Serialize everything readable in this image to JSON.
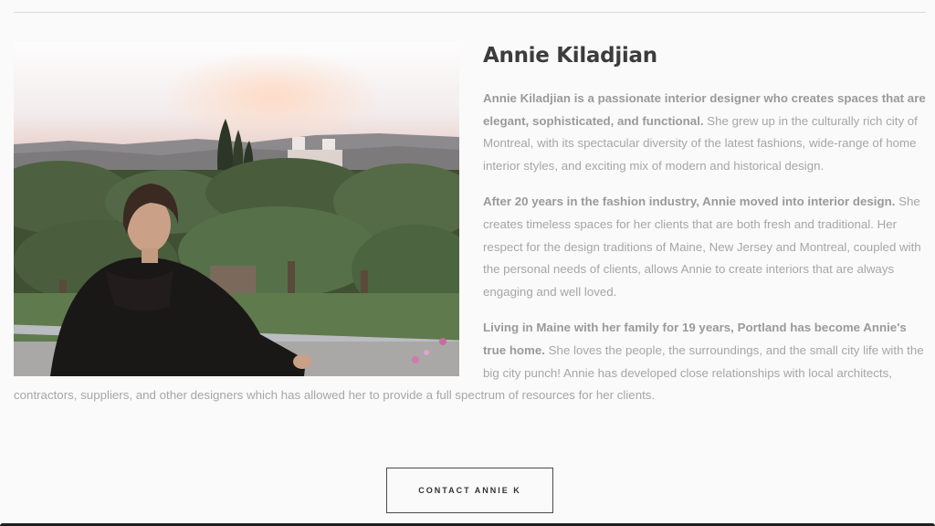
{
  "profile": {
    "name": "Annie Kiladjian",
    "photo_alt": "Annie Kiladjian",
    "paragraphs": [
      {
        "lead": "Annie Kiladjian is a passionate interior designer who creates spaces that are elegant, sophisticated, and functional.",
        "body": " She grew up in the culturally rich city of Montreal, with its spectacular diversity of the latest fashions, wide-range of home interior styles, and exciting mix of modern and historical design."
      },
      {
        "lead": "After 20 years in the fashion industry, Annie moved into interior design.",
        "body": " She creates timeless spaces for her clients that are both fresh and traditional. Her respect for the design traditions of Maine, New Jersey and Montreal, coupled with the personal needs of clients, allows Annie to create interiors that are always engaging and well loved."
      },
      {
        "lead": "Living in Maine with her family for 19 years, Portland has become Annie's true home.",
        "body": " She loves the people, the surroundings, and the small city life with the big city punch! Annie has developed close relationships with local architects, contractors, suppliers, and other designers which has allowed her to provide a full spectrum of resources for her clients."
      }
    ]
  },
  "cta": {
    "label": "CONTACT ANNIE K"
  },
  "colors": {
    "background": "#fafafa",
    "heading": "#3c3c3c",
    "body_text": "#a6a6a6",
    "button_border": "#4a4a4a"
  }
}
